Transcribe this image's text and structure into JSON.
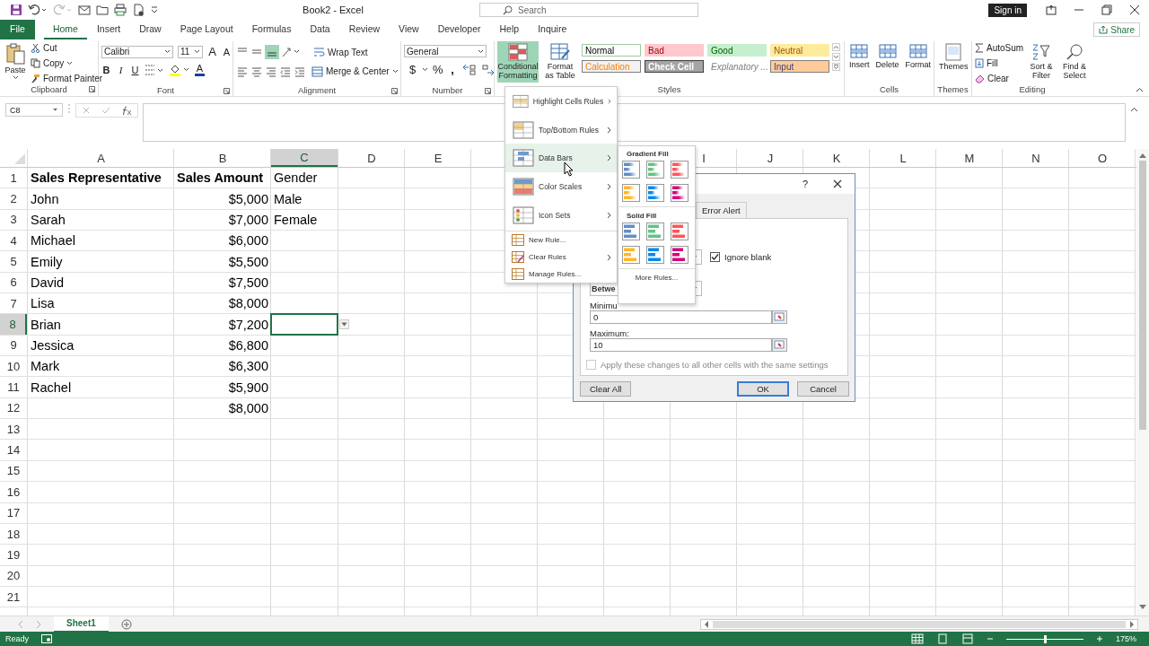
{
  "title_bar": {
    "title": "Book2  -  Excel",
    "search_placeholder": "Search",
    "sign_in": "Sign in"
  },
  "tabs": [
    {
      "label": "File",
      "kind": "file",
      "selected": false
    },
    {
      "label": "Home",
      "kind": "tab",
      "selected": true
    },
    {
      "label": "Insert",
      "kind": "tab",
      "selected": false
    },
    {
      "label": "Draw",
      "kind": "tab",
      "selected": false
    },
    {
      "label": "Page Layout",
      "kind": "tab",
      "selected": false
    },
    {
      "label": "Formulas",
      "kind": "tab",
      "selected": false
    },
    {
      "label": "Data",
      "kind": "tab",
      "selected": false
    },
    {
      "label": "Review",
      "kind": "tab",
      "selected": false
    },
    {
      "label": "View",
      "kind": "tab",
      "selected": false
    },
    {
      "label": "Developer",
      "kind": "tab",
      "selected": false
    },
    {
      "label": "Help",
      "kind": "tab",
      "selected": false
    },
    {
      "label": "Inquire",
      "kind": "tab",
      "selected": false
    }
  ],
  "share": "Share",
  "ribbon": {
    "clipboard": {
      "label": "Clipboard",
      "paste": "Paste",
      "cut": "Cut",
      "copy": "Copy",
      "format_painter": "Format Painter"
    },
    "font": {
      "label": "Font",
      "name": "Calibri",
      "size": "11",
      "grow": "A",
      "shrink": "A",
      "bold": "B",
      "italic": "I",
      "underline": "U",
      "color_letter": "A"
    },
    "alignment": {
      "label": "Alignment",
      "wrap_text": "Wrap Text",
      "merge_center": "Merge & Center"
    },
    "number": {
      "label": "Number",
      "format": "General",
      "currency": "$",
      "percent": "%",
      "comma": ","
    },
    "styles": {
      "label": "Styles",
      "conditional_formatting": {
        "label": "Conditional Formatting",
        "selected": true
      },
      "format_as_table": "Format as Table",
      "cell_styles": [
        {
          "label": "Normal",
          "kind": "normal"
        },
        {
          "label": "Bad",
          "kind": "bad"
        },
        {
          "label": "Good",
          "kind": "good"
        },
        {
          "label": "Neutral",
          "kind": "neutral"
        },
        {
          "label": "Calculation",
          "kind": "calculation"
        },
        {
          "label": "Check Cell",
          "kind": "check"
        },
        {
          "label": "Explanatory ...",
          "kind": "explanatory"
        },
        {
          "label": "Input",
          "kind": "input"
        }
      ]
    },
    "cells": {
      "label": "Cells",
      "buttons": [
        "Insert",
        "Delete",
        "Format"
      ]
    },
    "themes": {
      "label": "Themes",
      "button": "Themes"
    },
    "editing": {
      "label": "Editing",
      "autosum": "AutoSum",
      "fill": "Fill",
      "clear": "Clear",
      "sort_filter": "Sort & Filter",
      "find_select": "Find & Select"
    }
  },
  "formula_bar": {
    "name_box": "C8"
  },
  "sheet": {
    "columns": [
      {
        "label": "A",
        "selected": false
      },
      {
        "label": "B",
        "selected": false
      },
      {
        "label": "C",
        "selected": true
      },
      {
        "label": "D",
        "selected": false
      },
      {
        "label": "E",
        "selected": false
      },
      null,
      null,
      null,
      {
        "label": "I",
        "selected": false
      },
      {
        "label": "J",
        "selected": false
      },
      {
        "label": "K",
        "selected": false
      },
      {
        "label": "L",
        "selected": false
      },
      {
        "label": "M",
        "selected": false
      },
      {
        "label": "N",
        "selected": false
      },
      {
        "label": "O",
        "selected": false
      }
    ],
    "rows": [
      {
        "label": "1",
        "selected": false,
        "cells": [
          {
            "text": "Sales Representative",
            "bold": true
          },
          {
            "text": "Sales Amount",
            "bold": true
          },
          {
            "text": "Gender"
          }
        ]
      },
      {
        "label": "2",
        "selected": false,
        "cells": [
          {
            "text": "John"
          },
          {
            "text": "$5,000",
            "kind": "number"
          },
          {
            "text": "Male"
          }
        ]
      },
      {
        "label": "3",
        "selected": false,
        "cells": [
          {
            "text": "Sarah"
          },
          {
            "text": "$7,000",
            "kind": "number"
          },
          {
            "text": "Female"
          }
        ]
      },
      {
        "label": "4",
        "selected": false,
        "cells": [
          {
            "text": "Michael"
          },
          {
            "text": "$6,000",
            "kind": "number"
          }
        ]
      },
      {
        "label": "5",
        "selected": false,
        "cells": [
          {
            "text": "Emily"
          },
          {
            "text": "$5,500",
            "kind": "number"
          }
        ]
      },
      {
        "label": "6",
        "selected": false,
        "cells": [
          {
            "text": "David"
          },
          {
            "text": "$7,500",
            "kind": "number"
          }
        ]
      },
      {
        "label": "7",
        "selected": false,
        "cells": [
          {
            "text": "Lisa"
          },
          {
            "text": "$8,000",
            "kind": "number"
          }
        ]
      },
      {
        "label": "8",
        "selected": true,
        "cells": [
          {
            "text": "Brian"
          },
          {
            "text": "$7,200",
            "kind": "number"
          },
          {
            "active": true
          }
        ]
      },
      {
        "label": "9",
        "selected": false,
        "cells": [
          {
            "text": "Jessica"
          },
          {
            "text": "$6,800",
            "kind": "number"
          }
        ]
      },
      {
        "label": "10",
        "selected": false,
        "cells": [
          {
            "text": "Mark"
          },
          {
            "text": "$6,300",
            "kind": "number"
          }
        ]
      },
      {
        "label": "11",
        "selected": false,
        "cells": [
          {
            "text": "Rachel"
          },
          {
            "text": "$5,900",
            "kind": "number"
          }
        ]
      },
      {
        "label": "12",
        "selected": false,
        "cells": [
          null,
          {
            "text": "$8,000",
            "kind": "number"
          }
        ]
      },
      {
        "label": "13",
        "selected": false,
        "cells": []
      },
      {
        "label": "14",
        "selected": false,
        "cells": []
      },
      {
        "label": "15",
        "selected": false,
        "cells": []
      },
      {
        "label": "16",
        "selected": false,
        "cells": []
      },
      {
        "label": "17",
        "selected": false,
        "cells": []
      },
      {
        "label": "18",
        "selected": false,
        "cells": []
      },
      {
        "label": "19",
        "selected": false,
        "cells": []
      },
      {
        "label": "20",
        "selected": false,
        "cells": []
      },
      {
        "label": "21",
        "selected": false,
        "cells": []
      }
    ]
  },
  "conditional_menu": {
    "items": [
      {
        "label": "Highlight Cells Rules",
        "kind": "large",
        "has_submenu": true,
        "selected": false
      },
      {
        "label": "Top/Bottom Rules",
        "kind": "large",
        "has_submenu": true,
        "selected": false
      },
      {
        "label": "Data Bars",
        "kind": "large",
        "has_submenu": true,
        "selected": true
      },
      {
        "label": "Color Scales",
        "kind": "large",
        "has_submenu": true,
        "selected": false
      },
      {
        "label": "Icon Sets",
        "kind": "large",
        "has_submenu": true,
        "selected": false
      },
      {
        "label": "New Rule...",
        "kind": "small",
        "has_submenu": false,
        "selected": false
      },
      {
        "label": "Clear Rules",
        "kind": "small",
        "has_submenu": true,
        "selected": false
      },
      {
        "label": "Manage Rules...",
        "kind": "small",
        "has_submenu": false,
        "selected": false
      }
    ]
  },
  "data_bars_menu": {
    "sections": [
      {
        "title": "Gradient Fill",
        "kind": "gradient",
        "swatches": [
          {
            "color": "#638ec6"
          },
          {
            "color": "#63c384"
          },
          {
            "color": "#ff555a"
          },
          {
            "color": "#ffb628"
          },
          {
            "color": "#008aef"
          },
          {
            "color": "#d6007b"
          }
        ]
      },
      {
        "title": "Solid Fill",
        "kind": "solid",
        "swatches": [
          {
            "color": "#638ec6"
          },
          {
            "color": "#63c384"
          },
          {
            "color": "#ff555a"
          },
          {
            "color": "#ffb628"
          },
          {
            "color": "#008aef"
          },
          {
            "color": "#d6007b"
          }
        ]
      }
    ],
    "more_rules": "More Rules..."
  },
  "dialog": {
    "help": "?",
    "tab": "Error Alert",
    "ignore_blank": {
      "label": "Ignore blank",
      "checked": true
    },
    "data_dropdown": "Betwe",
    "minimum_label": "Minimu",
    "minimum": "0",
    "maximum_label": "Maximum:",
    "maximum": "10",
    "apply_all": {
      "label": "Apply these changes to all other cells with the same settings",
      "checked": false,
      "disabled": true
    },
    "buttons": [
      {
        "label": "Clear All",
        "kind": "secondary"
      },
      {
        "label": "OK",
        "kind": "default"
      },
      {
        "label": "Cancel",
        "kind": "secondary"
      }
    ]
  },
  "sheet_tabs": [
    {
      "label": "Sheet1",
      "selected": true
    }
  ],
  "status_bar": {
    "status": "Ready",
    "zoom": "175%",
    "zoom_slider": {
      "level": 0.5
    }
  }
}
